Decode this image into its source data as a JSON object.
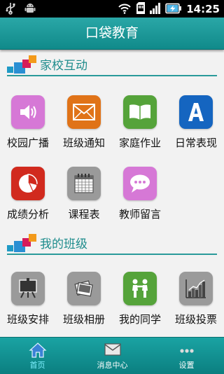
{
  "status_bar": {
    "time": "14:25",
    "icons": [
      "usb-icon",
      "android-icon",
      "wifi-icon",
      "sd-card-icon",
      "signal-icon",
      "battery-charging-icon"
    ]
  },
  "header": {
    "title": "口袋教育"
  },
  "sections": [
    {
      "title": "家校互动",
      "items": [
        {
          "label": "校园广播",
          "icon": "speaker-icon",
          "color": "#d678d6"
        },
        {
          "label": "班级通知",
          "icon": "envelope-icon",
          "color": "#e07318"
        },
        {
          "label": "家庭作业",
          "icon": "book-icon",
          "color": "#55a33a"
        },
        {
          "label": "日常表现",
          "icon": "letter-a-icon",
          "color": "#1565c0"
        },
        {
          "label": "成绩分析",
          "icon": "pie-chart-icon",
          "color": "#d12a1e"
        },
        {
          "label": "课程表",
          "icon": "calendar-icon",
          "color": "#9a9a9a"
        },
        {
          "label": "教师留言",
          "icon": "speech-bubble-icon",
          "color": "#d678d6"
        }
      ]
    },
    {
      "title": "我的班级",
      "items": [
        {
          "label": "班级安排",
          "icon": "easel-icon",
          "color": "#9a9a9a"
        },
        {
          "label": "班级相册",
          "icon": "photos-icon",
          "color": "#9a9a9a"
        },
        {
          "label": "我的同学",
          "icon": "classmates-icon",
          "color": "#55a33a"
        },
        {
          "label": "班级投票",
          "icon": "bar-chart-icon",
          "color": "#9a9a9a"
        }
      ]
    }
  ],
  "bottom_nav": [
    {
      "label": "首页",
      "icon": "home-icon",
      "active": true
    },
    {
      "label": "消息中心",
      "icon": "message-icon",
      "active": false
    },
    {
      "label": "设置",
      "icon": "more-icon",
      "active": false
    }
  ],
  "colors": {
    "accent": "#1a9a9a",
    "section_title": "#1e8c8c",
    "nav_active_label": "#7ff0ff",
    "nav_label": "#ffffff"
  }
}
